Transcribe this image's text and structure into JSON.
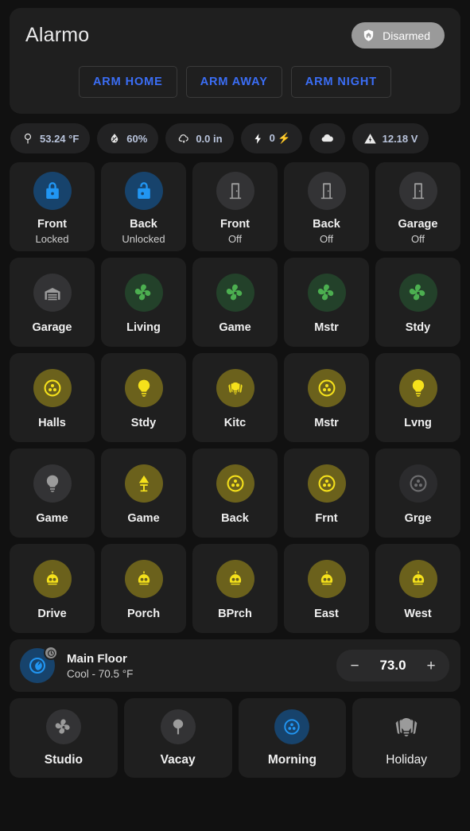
{
  "alarmo": {
    "title": "Alarmo",
    "state_label": "Disarmed",
    "state_icon": "shield-home-icon",
    "state_color": "#9a9a9a",
    "accent_color": "#3b6ef6",
    "buttons": [
      {
        "label": "ARM HOME",
        "name": "arm-home-button"
      },
      {
        "label": "ARM AWAY",
        "name": "arm-away-button"
      },
      {
        "label": "ARM NIGHT",
        "name": "arm-night-button"
      }
    ]
  },
  "chips": [
    {
      "icon": "thermometer-outdoor-icon",
      "value": "53.24 °F",
      "name": "chip-temperature"
    },
    {
      "icon": "humidity-icon",
      "value": "60%",
      "name": "chip-humidity"
    },
    {
      "icon": "rain-icon",
      "value": "0.0 in",
      "name": "chip-rainfall"
    },
    {
      "icon": "lightning-bolt-icon",
      "value": "0 ⚡",
      "name": "chip-lightning"
    },
    {
      "icon": "cloud-icon",
      "value": "",
      "name": "chip-cloud"
    },
    {
      "icon": "warning-voltage-icon",
      "value": "12.18 V",
      "name": "chip-voltage"
    }
  ],
  "tiles": [
    [
      {
        "name": "Front",
        "state": "Locked",
        "icon": "lock-closed-icon",
        "color": "blue"
      },
      {
        "name": "Back",
        "state": "Unlocked",
        "icon": "lock-open-icon",
        "color": "blue"
      },
      {
        "name": "Front",
        "state": "Off",
        "icon": "door-icon",
        "color": "grey"
      },
      {
        "name": "Back",
        "state": "Off",
        "icon": "door-icon",
        "color": "grey"
      },
      {
        "name": "Garage",
        "state": "Off",
        "icon": "door-icon",
        "color": "grey"
      }
    ],
    [
      {
        "name": "Garage",
        "state": "",
        "icon": "garage-icon",
        "color": "grey"
      },
      {
        "name": "Living",
        "state": "",
        "icon": "fan-icon",
        "color": "green"
      },
      {
        "name": "Game",
        "state": "",
        "icon": "fan-icon",
        "color": "green"
      },
      {
        "name": "Mstr",
        "state": "",
        "icon": "fan-icon",
        "color": "green"
      },
      {
        "name": "Stdy",
        "state": "",
        "icon": "fan-icon",
        "color": "green"
      }
    ],
    [
      {
        "name": "Halls",
        "state": "",
        "icon": "ceiling-light-icon",
        "color": "yellow"
      },
      {
        "name": "Stdy",
        "state": "",
        "icon": "bulb-icon",
        "color": "yellow"
      },
      {
        "name": "Kitc",
        "state": "",
        "icon": "light-group-icon",
        "color": "yellow"
      },
      {
        "name": "Mstr",
        "state": "",
        "icon": "ceiling-light-icon",
        "color": "yellow"
      },
      {
        "name": "Lvng",
        "state": "",
        "icon": "bulb-icon",
        "color": "yellow"
      }
    ],
    [
      {
        "name": "Game",
        "state": "",
        "icon": "bulb-icon",
        "color": "grey"
      },
      {
        "name": "Game",
        "state": "",
        "icon": "table-lamp-icon",
        "color": "yellow"
      },
      {
        "name": "Back",
        "state": "",
        "icon": "ceiling-light-icon",
        "color": "yellow"
      },
      {
        "name": "Frnt",
        "state": "",
        "icon": "ceiling-light-icon",
        "color": "yellow"
      },
      {
        "name": "Grge",
        "state": "",
        "icon": "ceiling-light-icon",
        "color": "dim"
      }
    ],
    [
      {
        "name": "Drive",
        "state": "",
        "icon": "flood-light-icon",
        "color": "yellow"
      },
      {
        "name": "Porch",
        "state": "",
        "icon": "flood-light-icon",
        "color": "yellow"
      },
      {
        "name": "BPrch",
        "state": "",
        "icon": "flood-light-icon",
        "color": "yellow"
      },
      {
        "name": "East",
        "state": "",
        "icon": "flood-light-icon",
        "color": "yellow"
      },
      {
        "name": "West",
        "state": "",
        "icon": "flood-light-icon",
        "color": "yellow"
      }
    ]
  ],
  "thermostat": {
    "name": "Main Floor",
    "status": "Cool - 70.5 °F",
    "target": "73.0",
    "decrease_label": "−",
    "increase_label": "+",
    "icon": "thermostat-icon",
    "badge_icon": "clock-icon"
  },
  "scenes": [
    {
      "label": "Studio",
      "icon": "fan-icon",
      "color": "grey",
      "big": false
    },
    {
      "label": "Vacay",
      "icon": "tree-icon",
      "color": "grey",
      "big": false
    },
    {
      "label": "Morning",
      "icon": "ceiling-light-icon",
      "color": "blue",
      "big": false
    },
    {
      "label": "Holiday",
      "icon": "light-group-icon",
      "color": "none",
      "big": true
    }
  ]
}
